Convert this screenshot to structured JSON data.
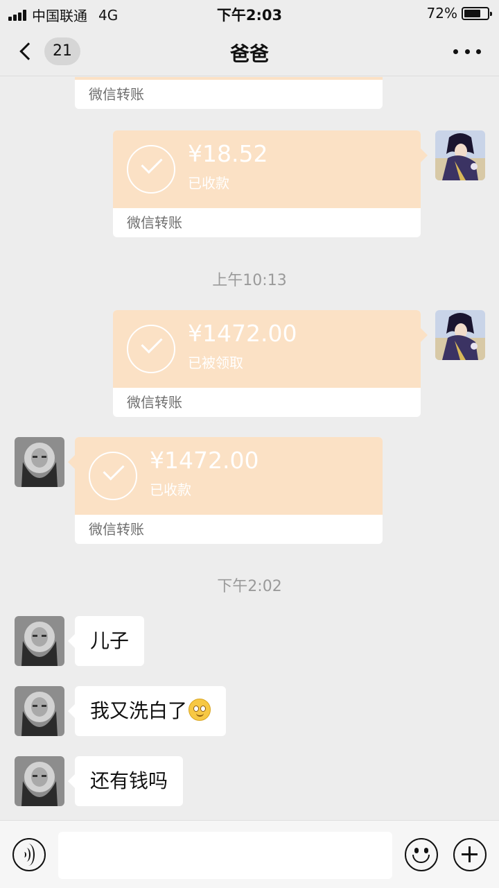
{
  "status_bar": {
    "carrier": "中国联通",
    "network": "4G",
    "time": "下午2:03",
    "battery_text": "72%",
    "battery_level": 0.72
  },
  "nav": {
    "back_badge": "21",
    "title": "爸爸"
  },
  "messages": {
    "transfer_0": {
      "label": "微信转账"
    },
    "transfer_1": {
      "amount": "¥18.52",
      "status": "已收款",
      "label": "微信转账"
    },
    "time_1": "上午10:13",
    "transfer_2": {
      "amount": "¥1472.00",
      "status": "已被领取",
      "label": "微信转账"
    },
    "transfer_3": {
      "amount": "¥1472.00",
      "status": "已收款",
      "label": "微信转账"
    },
    "time_2": "下午2:02",
    "text_1": "儿子",
    "text_2": "我又洗白了",
    "text_3": "还有钱吗"
  },
  "colors": {
    "transfer_bg": "#fbe1c5",
    "chat_bg": "#ededed"
  },
  "icons": {
    "self_avatar": "anime-character-avatar",
    "contact_avatar": "bearded-man-portrait-avatar",
    "emoji": "smiling-face-emoji"
  },
  "input": {
    "placeholder": ""
  }
}
